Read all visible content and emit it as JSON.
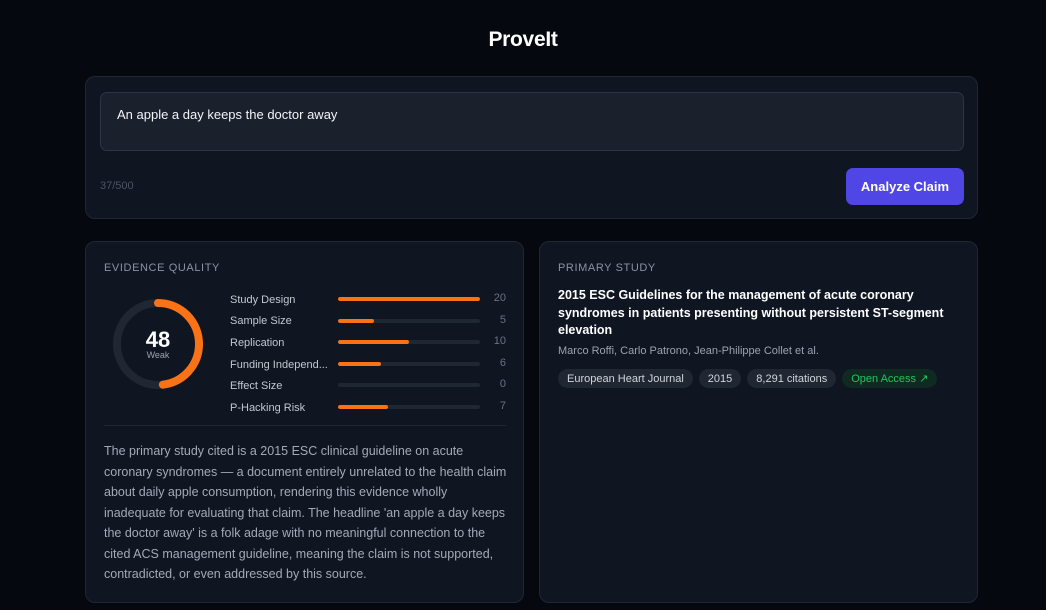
{
  "app": {
    "title": "ProveIt"
  },
  "claim_input": {
    "value": "An apple a day keeps the doctor away",
    "char_count": "37/500",
    "analyze_label": "Analyze Claim"
  },
  "evidence_quality": {
    "label": "EVIDENCE QUALITY",
    "score": "48",
    "score_label": "Weak",
    "score_value": 48,
    "score_max": 100,
    "metrics": [
      {
        "name": "Study Design",
        "score": "20",
        "value": 20
      },
      {
        "name": "Sample Size",
        "score": "5",
        "value": 5
      },
      {
        "name": "Replication",
        "score": "10",
        "value": 10
      },
      {
        "name": "Funding Independ...",
        "score": "6",
        "value": 6
      },
      {
        "name": "Effect Size",
        "score": "0",
        "value": 0
      },
      {
        "name": "P-Hacking Risk",
        "score": "7",
        "value": 7
      }
    ],
    "metric_max": 20,
    "summary": "The primary study cited is a 2015 ESC clinical guideline on acute coronary syndromes — a document entirely unrelated to the health claim about daily apple consumption, rendering this evidence wholly inadequate for evaluating that claim. The headline 'an apple a day keeps the doctor away' is a folk adage with no meaningful connection to the cited ACS management guideline, meaning the claim is not supported, contradicted, or even addressed by this source."
  },
  "primary_study": {
    "label": "PRIMARY STUDY",
    "title": "2015 ESC Guidelines for the management of acute coronary syndromes in patients presenting without persistent ST-segment elevation",
    "authors": "Marco Roffi, Carlo Patrono, Jean-Philippe Collet et al.",
    "journal": "European Heart Journal",
    "year": "2015",
    "citations": "8,291 citations",
    "open_access": "Open Access ↗"
  },
  "colors": {
    "accent": "#4f46e5",
    "score_orange": "#f97316",
    "open_access_green": "#22c55e"
  }
}
